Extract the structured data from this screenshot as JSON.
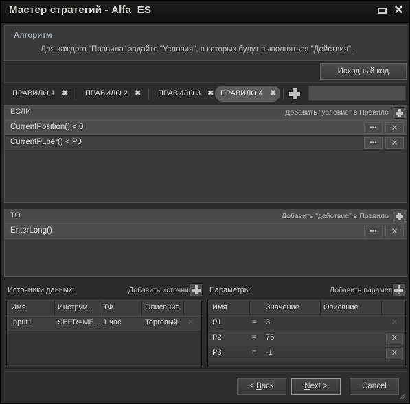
{
  "window": {
    "title": "Мастер стратегий - Alfa_ES",
    "minimize_icon": "minimize-icon",
    "close_icon": "close-icon"
  },
  "algorithm": {
    "title": "Алгоритм",
    "description": "Для каждого \"Правила\" задайте \"Условия\", в которых будут выполняться \"Действия\"."
  },
  "toolbar": {
    "source_code_label": "Исходный код"
  },
  "tabs": {
    "items": [
      {
        "label": "ПРАВИЛО 1",
        "close": "✖",
        "active": false
      },
      {
        "label": "ПРАВИЛО 2",
        "close": "✖",
        "active": false
      },
      {
        "label": "ПРАВИЛО 3",
        "close": "✖",
        "active": false
      },
      {
        "label": "ПРАВИЛО 4",
        "close": "✖",
        "active": true
      }
    ],
    "add_tab_icon": "plus-icon",
    "name_field_value": ""
  },
  "if_section": {
    "header_label": "ЕСЛИ",
    "add_label": "Добавить \"условие\" в Правило",
    "add_icon": "plus-icon",
    "rows": [
      {
        "text": "CurrentPosition() < 0",
        "selected": true,
        "dots": "•••",
        "close": "✕"
      },
      {
        "text": "CurrentPLper() < P3",
        "selected": false,
        "dots": "•••",
        "close": "✕"
      }
    ]
  },
  "then_section": {
    "header_label": "ТО",
    "add_label": "Добавить \"действие\" в Правило",
    "add_icon": "plus-icon",
    "rows": [
      {
        "text": "EnterLong()",
        "selected": true,
        "dots": "•••",
        "close": "✕"
      }
    ]
  },
  "data_sources": {
    "title": "Источники данных:",
    "add_label": "Добавить источник",
    "add_icon": "plus-icon",
    "columns": [
      "Имя",
      "Инструм...",
      "ТФ",
      "Описание"
    ],
    "rows": [
      {
        "name": "Input1",
        "instrument": "SBER=МБ...",
        "tf": "1 час",
        "description": "Торговый",
        "close": "✕",
        "close_enabled": false
      }
    ]
  },
  "parameters": {
    "title": "Параметры:",
    "add_label": "Добавить параметр",
    "add_icon": "plus-icon",
    "columns": [
      "Имя",
      "",
      "Значение",
      "Описание"
    ],
    "rows": [
      {
        "name": "P1",
        "eq": "=",
        "value": "3",
        "description": "",
        "close": "✕",
        "close_enabled": false
      },
      {
        "name": "P2",
        "eq": "=",
        "value": "75",
        "description": "",
        "close": "✕",
        "close_enabled": true
      },
      {
        "name": "P3",
        "eq": "=",
        "value": "-1",
        "description": "",
        "close": "✕",
        "close_enabled": true
      }
    ]
  },
  "footer": {
    "back_label": "< Back",
    "next_label": "Next >",
    "cancel_label": "Cancel"
  },
  "colors": {
    "window_bg": "#2b2b2b",
    "panel_bg": "#3a3a3a",
    "header_accent": "#a4adbb",
    "active_tab_bg": "#5b5b5b"
  }
}
